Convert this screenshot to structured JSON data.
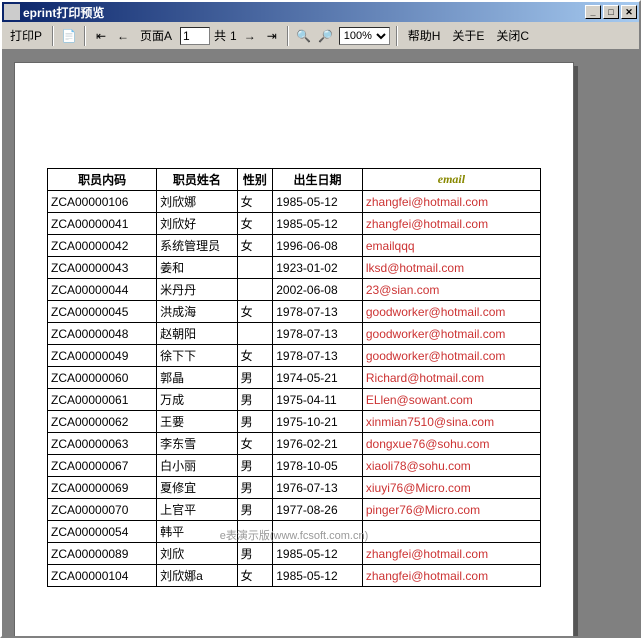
{
  "titlebar": {
    "title": "eprint打印预览"
  },
  "toolbar": {
    "print": "打印P",
    "page_label": "页面A",
    "page_value": "1",
    "total_label": "共",
    "total_value": "1",
    "zoom": "100%",
    "help": "帮助H",
    "about": "关于E",
    "close": "关闭C"
  },
  "table": {
    "headers": [
      "职员内码",
      "职员姓名",
      "性别",
      "出生日期",
      "email"
    ],
    "rows": [
      {
        "id": "ZCA00000106",
        "name": "刘欣娜",
        "gender": "女",
        "birth": "1985-05-12",
        "email": "zhangfei@hotmail.com"
      },
      {
        "id": "ZCA00000041",
        "name": "刘欣好",
        "gender": "女",
        "birth": "1985-05-12",
        "email": "zhangfei@hotmail.com"
      },
      {
        "id": "ZCA00000042",
        "name": "系统管理员",
        "gender": "女",
        "birth": "1996-06-08",
        "email": "emailqqq"
      },
      {
        "id": "ZCA00000043",
        "name": "姜和",
        "gender": "",
        "birth": "1923-01-02",
        "email": "lksd@hotmail.com"
      },
      {
        "id": "ZCA00000044",
        "name": "米丹丹",
        "gender": "",
        "birth": "2002-06-08",
        "email": "23@sian.com"
      },
      {
        "id": "ZCA00000045",
        "name": "洪成海",
        "gender": "女",
        "birth": "1978-07-13",
        "email": "goodworker@hotmail.com"
      },
      {
        "id": "ZCA00000048",
        "name": "赵朝阳",
        "gender": "",
        "birth": "1978-07-13",
        "email": "goodworker@hotmail.com"
      },
      {
        "id": "ZCA00000049",
        "name": "徐下下",
        "gender": "女",
        "birth": "1978-07-13",
        "email": "goodworker@hotmail.com"
      },
      {
        "id": "ZCA00000060",
        "name": "郭晶",
        "gender": "男",
        "birth": "1974-05-21",
        "email": "Richard@hotmail.com"
      },
      {
        "id": "ZCA00000061",
        "name": "万成",
        "gender": "男",
        "birth": "1975-04-11",
        "email": "ELlen@sowant.com"
      },
      {
        "id": "ZCA00000062",
        "name": "王要",
        "gender": "男",
        "birth": "1975-10-21",
        "email": "xinmian7510@sina.com"
      },
      {
        "id": "ZCA00000063",
        "name": "李东雪",
        "gender": "女",
        "birth": "1976-02-21",
        "email": "dongxue76@sohu.com"
      },
      {
        "id": "ZCA00000067",
        "name": "白小丽",
        "gender": "男",
        "birth": "1978-10-05",
        "email": "xiaoli78@sohu.com"
      },
      {
        "id": "ZCA00000069",
        "name": "夏修宜",
        "gender": "男",
        "birth": "1976-07-13",
        "email": "xiuyi76@Micro.com"
      },
      {
        "id": "ZCA00000070",
        "name": "上官平",
        "gender": "男",
        "birth": "1977-08-26",
        "email": "pinger76@Micro.com"
      },
      {
        "id": "ZCA00000054",
        "name": "韩平",
        "gender": "",
        "birth": "",
        "email": ""
      },
      {
        "id": "ZCA00000089",
        "name": "刘欣",
        "gender": "男",
        "birth": "1985-05-12",
        "email": "zhangfei@hotmail.com"
      },
      {
        "id": "ZCA00000104",
        "name": "刘欣娜a",
        "gender": "女",
        "birth": "1985-05-12",
        "email": "zhangfei@hotmail.com"
      }
    ]
  },
  "watermark": "e表演示版(www.fcsoft.com.cn)"
}
